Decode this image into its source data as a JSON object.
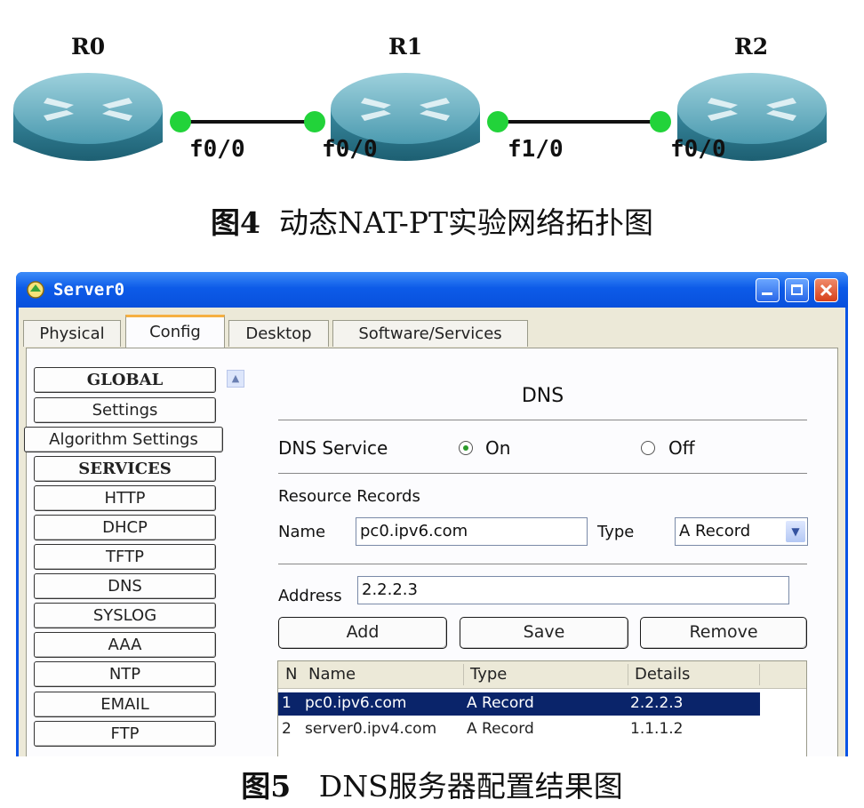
{
  "figure4": {
    "routers": [
      {
        "name": "R0"
      },
      {
        "name": "R1"
      },
      {
        "name": "R2"
      }
    ],
    "interfaces": [
      "f0/0",
      "f0/0",
      "f1/0",
      "f0/0"
    ],
    "caption_num": "图4",
    "caption_text": "动态NAT-PT实验网络拓扑图"
  },
  "window": {
    "title": "Server0",
    "tabs": [
      "Physical",
      "Config",
      "Desktop",
      "Software/Services"
    ],
    "active_tab": "Config",
    "sidebar": [
      "GLOBAL",
      "Settings",
      "Algorithm Settings",
      "SERVICES",
      "HTTP",
      "DHCP",
      "TFTP",
      "DNS",
      "SYSLOG",
      "AAA",
      "NTP",
      "EMAIL",
      "FTP"
    ],
    "dns": {
      "title": "DNS",
      "service_label": "DNS Service",
      "on_label": "On",
      "off_label": "Off",
      "service_state": "On",
      "resource_records_label": "Resource Records",
      "name_label": "Name",
      "name_value": "pc0.ipv6.com",
      "type_label": "Type",
      "type_value": "A Record",
      "address_label": "Address",
      "address_value": "2.2.2.3",
      "add_label": "Add",
      "save_label": "Save",
      "remove_label": "Remove",
      "table": {
        "headers": [
          "N",
          "Name",
          "Type",
          "Details"
        ],
        "rows": [
          {
            "n": "1",
            "name": "pc0.ipv6.com",
            "type": "A Record",
            "details": "2.2.2.3"
          },
          {
            "n": "2",
            "name": "server0.ipv4.com",
            "type": "A Record",
            "details": "1.1.1.2"
          }
        ]
      }
    }
  },
  "figure5": {
    "caption_num": "图5",
    "caption_text": "DNS服务器配置结果图"
  },
  "colors": {
    "router_body": "#3f8ea3",
    "link_dot": "#22d33a",
    "titlebar": "#0a55e6",
    "selection": "#0a246a"
  }
}
